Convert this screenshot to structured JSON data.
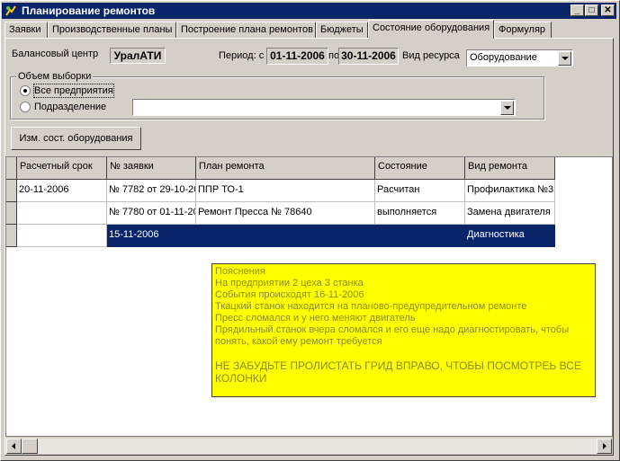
{
  "window": {
    "title": "Планирование ремонтов",
    "buttons": {
      "minimize": "_",
      "maximize": "□",
      "close": "✕"
    }
  },
  "tabs": [
    {
      "label": "Заявки",
      "active": false
    },
    {
      "label": "Производственные планы",
      "active": false
    },
    {
      "label": "Построение плана ремонтов",
      "active": false
    },
    {
      "label": "Бюджеты",
      "active": false
    },
    {
      "label": "Состояние оборудования",
      "active": true
    },
    {
      "label": "Формуляр",
      "active": false
    }
  ],
  "form": {
    "balance_center_label": "Балансовый центр",
    "balance_center_value": "УралАТИ",
    "period_label": "Период: с",
    "period_from": "01-11-2006",
    "period_to_label": "по",
    "period_to": "30-11-2006",
    "resource_type_label": "Вид ресурса",
    "resource_type_value": "Оборудование",
    "sample_group_label": "Объем выборки",
    "radio_all": "Все предприятия",
    "radio_division": "Подразделение",
    "division_value": "",
    "change_button": "Изм. сост. оборудования"
  },
  "grid": {
    "columns": [
      "Расчетный срок",
      "№ заявки",
      "План ремонта",
      "Состояние",
      "Вид ремонта"
    ],
    "rows": [
      {
        "cells": [
          "20-11-2006",
          "№ 7782 от 29-10-20",
          "ППР ТО-1",
          "Расчитан",
          "Профилактика №3"
        ],
        "selected": false
      },
      {
        "cells": [
          "",
          "№ 7780 от 01-11-20",
          "Ремонт Пресса № 78640",
          "выполняется",
          "Замена двигателя"
        ],
        "selected": false
      },
      {
        "cells": [
          "",
          "15-11-2006",
          "",
          "",
          "Диагностика"
        ],
        "selected": true
      }
    ]
  },
  "note": {
    "lines": [
      "Пояснения",
      "На предприятии 2 цеха 3 станка",
      "События происходят 16-11-2006",
      "Ткацкий станок находится на планово-предупредительном ремонте",
      "Пресс сломался и у него меняют двигатель",
      "Прядильный станок вчера сломался и его еще надо диагностировать, чтобы понять, какой ему ремонт требуется",
      "",
      "НЕ ЗАБУДЬТЕ ПРОЛИСТАТЬ ГРИД ВПРАВО, ЧТОБЫ ПОСМОТРЕЬ ВСЕ КОЛОНКИ"
    ]
  },
  "colors": {
    "title_bar": "#0a246a",
    "note_bg": "#ffff00",
    "selection": "#0a246a"
  }
}
